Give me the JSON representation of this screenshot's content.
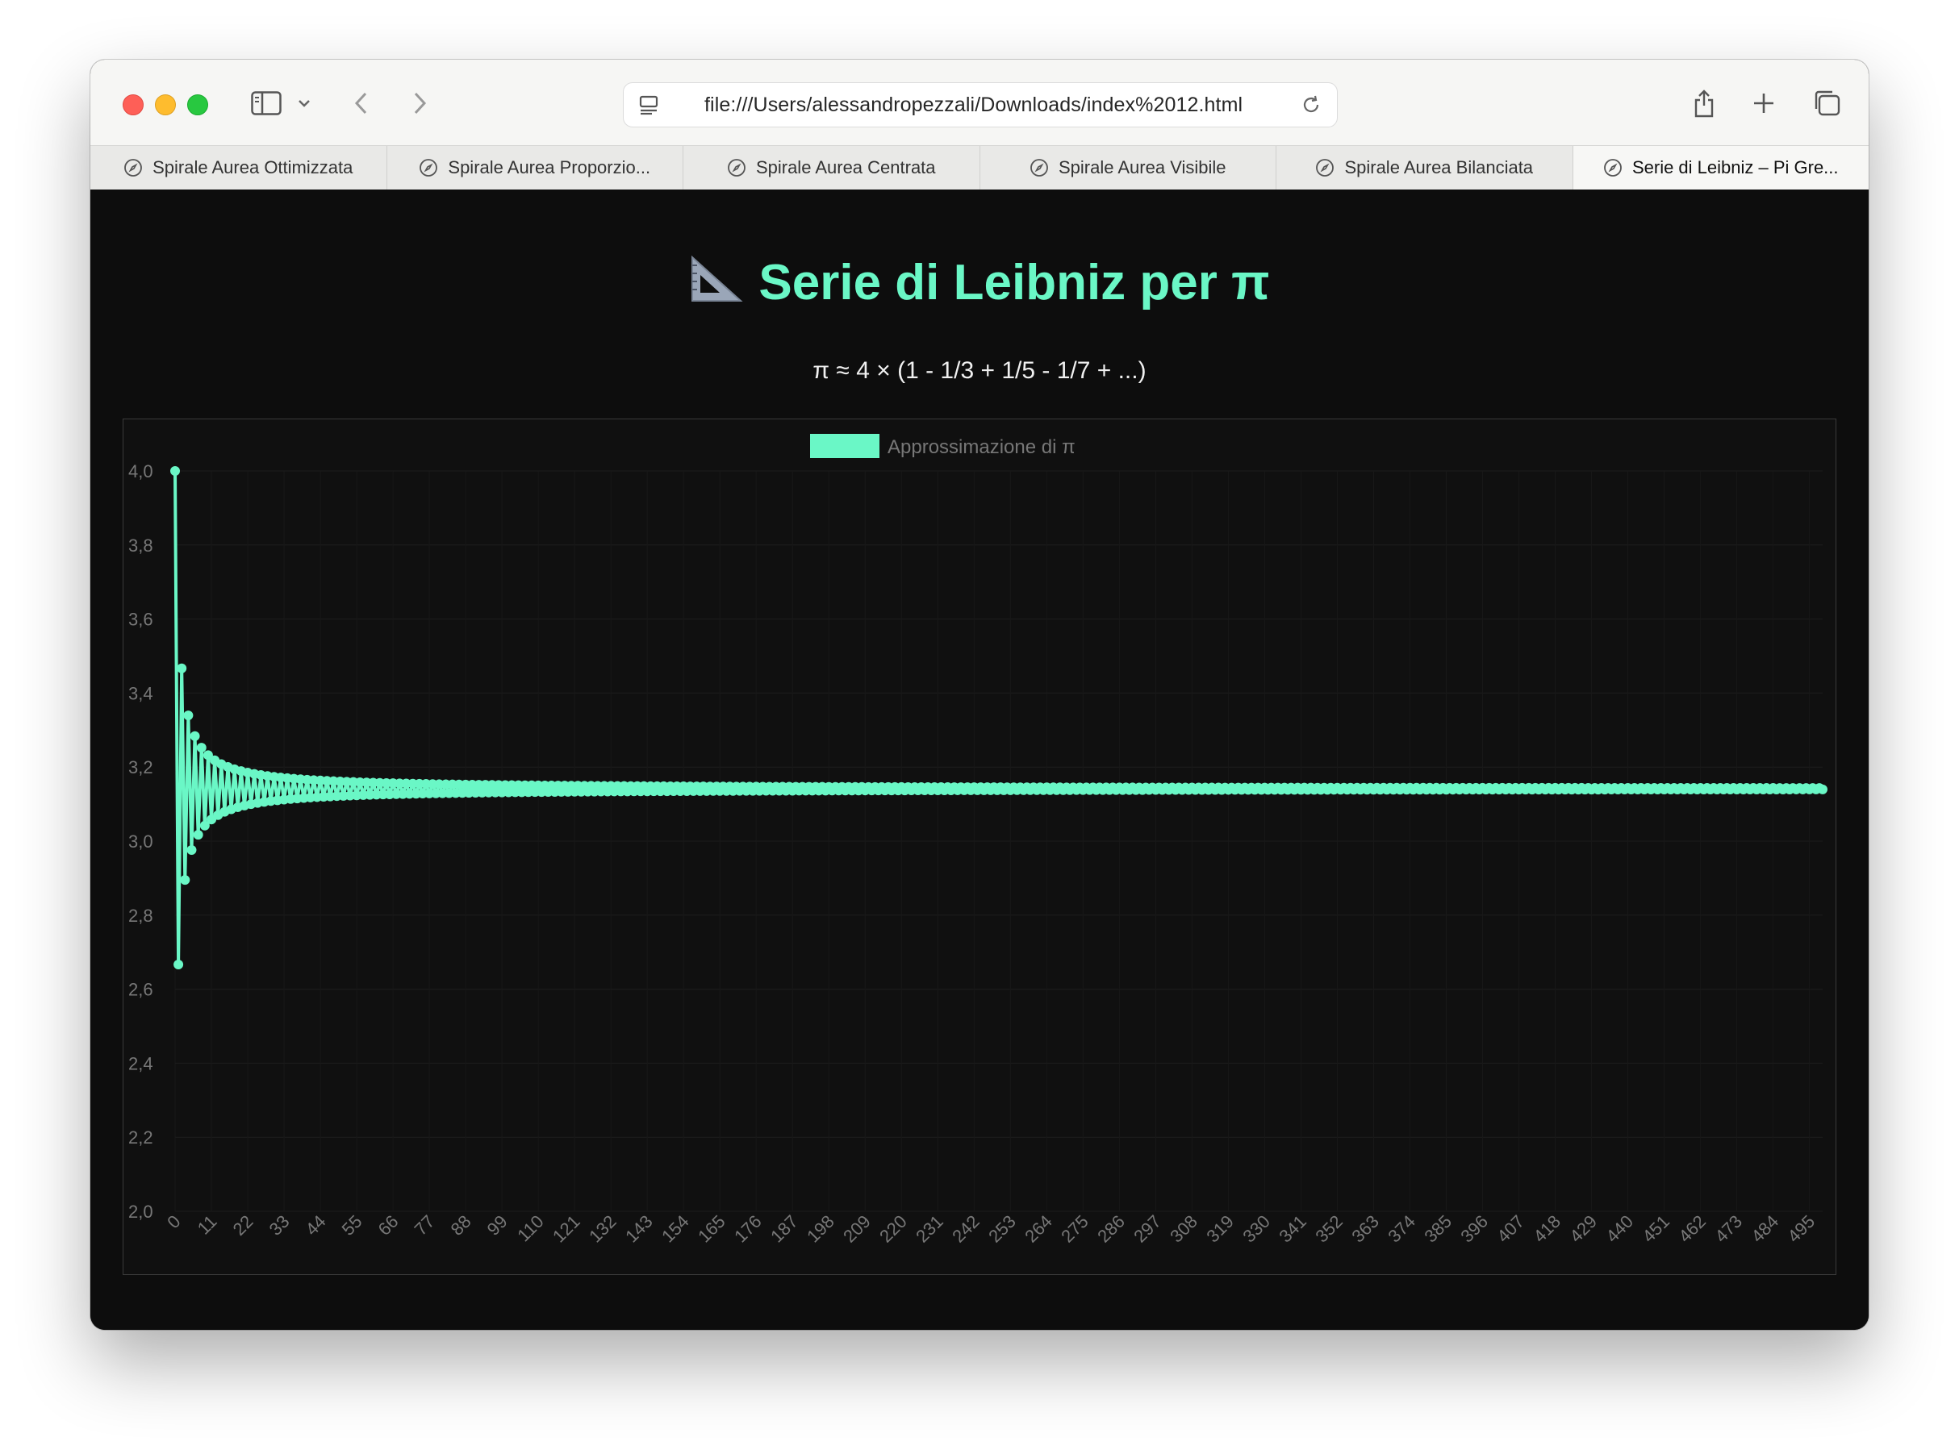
{
  "browser": {
    "url": "file:///Users/alessandropezzali/Downloads/index%2012.html",
    "tabs": [
      {
        "label": "Spirale Aurea Ottimizzata",
        "active": false
      },
      {
        "label": "Spirale Aurea Proporzio...",
        "active": false
      },
      {
        "label": "Spirale Aurea Centrata",
        "active": false
      },
      {
        "label": "Spirale Aurea Visibile",
        "active": false
      },
      {
        "label": "Spirale Aurea Bilanciata",
        "active": false
      },
      {
        "label": "Serie di Leibniz – Pi Gre...",
        "active": true
      }
    ]
  },
  "page": {
    "title": "Serie di Leibniz per π",
    "title_icon": "triangular-ruler-icon",
    "subtitle": "π ≈ 4 × (1 - 1/3 + 1/5 - 1/7 + ...)"
  },
  "chart_data": {
    "type": "line",
    "legend": "Approssimazione di π",
    "legend_position": "top",
    "line_color": "#6af7c6",
    "x_label_step": 11,
    "x_range": [
      0,
      499
    ],
    "ylim": [
      2.0,
      4.0
    ],
    "y_ticks": [
      "4,0",
      "3,8",
      "3,6",
      "3,4",
      "3,2",
      "3,0",
      "2,8",
      "2,6",
      "2,4",
      "2,2",
      "2,0"
    ],
    "x_ticks": [
      "0",
      "11",
      "22",
      "33",
      "44",
      "55",
      "66",
      "77",
      "88",
      "99",
      "110",
      "121",
      "132",
      "143",
      "154",
      "165",
      "176",
      "187",
      "198",
      "209",
      "220",
      "231",
      "242",
      "253",
      "264",
      "275",
      "286",
      "297",
      "308",
      "319",
      "330",
      "341",
      "352",
      "363",
      "374",
      "385",
      "396",
      "407",
      "418",
      "429",
      "440",
      "451",
      "462",
      "473",
      "484",
      "495"
    ],
    "series": [
      {
        "name": "Approssimazione di π",
        "formula": "4 × Σ (-1)^k / (2k+1), k = 0..n",
        "n_points": 500
      }
    ]
  }
}
